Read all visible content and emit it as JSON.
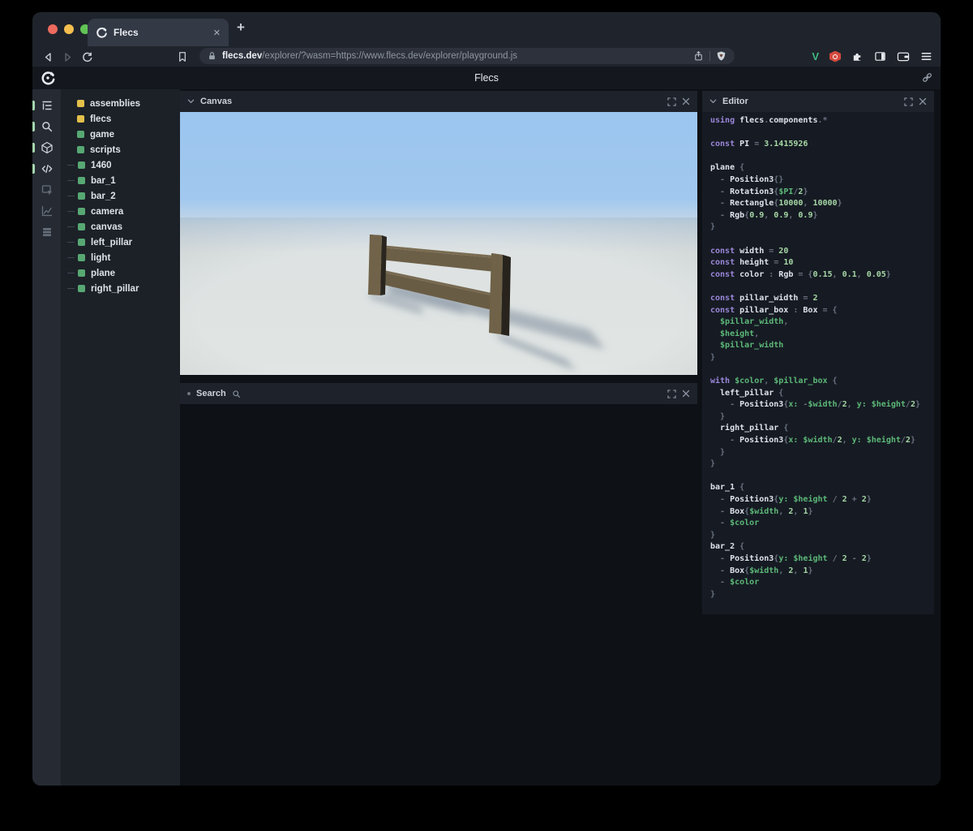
{
  "colors": {
    "traffic_red": "#ed6a5e",
    "traffic_yellow": "#f5bf4f",
    "traffic_green": "#61c454",
    "module_yellow": "#e3c04b",
    "entity_green": "#57a873",
    "rail_marker": "#a5d6ae",
    "syn_kw": "#9b86d9",
    "syn_id": "#dde3ea",
    "syn_pn": "#68707f",
    "syn_var": "#5cb878",
    "syn_num": "#a6d7a6",
    "ext_v_green": "#42b883",
    "ext_hex_red": "#d4493f",
    "sky_top": "#9bc5ef",
    "ground": "#e0e4e3",
    "fence_front": "#6e6148",
    "fence_side": "#2a261f",
    "fence_top": "#7a6c51",
    "shadow": "#5d7085"
  },
  "browser": {
    "tab_title": "Flecs",
    "close_glyph": "✕",
    "new_tab_glyph": "+",
    "url_domain": "flecs.dev",
    "url_path": "/explorer/?wasm=https://www.flecs.dev/explorer/playground.js",
    "ext_v_label": "V"
  },
  "page": {
    "title": "Flecs"
  },
  "icon_rail": {
    "items": [
      {
        "name": "tree",
        "active": true
      },
      {
        "name": "search",
        "active": true
      },
      {
        "name": "cube",
        "active": true
      },
      {
        "name": "code",
        "active": true
      },
      {
        "name": "inspector",
        "active": false
      },
      {
        "name": "chart",
        "active": false
      },
      {
        "name": "rows",
        "active": false
      }
    ]
  },
  "tree": {
    "items": [
      {
        "label": "assemblies",
        "type": "module",
        "expandable": true
      },
      {
        "label": "flecs",
        "type": "module",
        "expandable": true
      },
      {
        "label": "game",
        "type": "entity",
        "expandable": true
      },
      {
        "label": "scripts",
        "type": "entity",
        "expandable": true
      },
      {
        "label": "1460",
        "type": "entity",
        "expandable": false
      },
      {
        "label": "bar_1",
        "type": "entity",
        "expandable": false
      },
      {
        "label": "bar_2",
        "type": "entity",
        "expandable": false
      },
      {
        "label": "camera",
        "type": "entity",
        "expandable": false
      },
      {
        "label": "canvas",
        "type": "entity",
        "expandable": false
      },
      {
        "label": "left_pillar",
        "type": "entity",
        "expandable": false
      },
      {
        "label": "light",
        "type": "entity",
        "expandable": false
      },
      {
        "label": "plane",
        "type": "entity",
        "expandable": false
      },
      {
        "label": "right_pillar",
        "type": "entity",
        "expandable": false
      }
    ]
  },
  "panels": {
    "canvas_title": "Canvas",
    "search_title": "Search",
    "editor_title": "Editor"
  },
  "editor": {
    "code_lines": [
      [
        [
          "k",
          "using "
        ],
        [
          "i",
          "flecs"
        ],
        [
          "p",
          "."
        ],
        [
          "i",
          "components"
        ],
        [
          "p",
          ".*"
        ]
      ],
      [],
      [
        [
          "k",
          "const "
        ],
        [
          "i",
          "PI"
        ],
        [
          "p",
          " = "
        ],
        [
          "n",
          "3.1415926"
        ]
      ],
      [],
      [
        [
          "i",
          "plane "
        ],
        [
          "p",
          "{"
        ]
      ],
      [
        [
          "p",
          "  - "
        ],
        [
          "i",
          "Position3"
        ],
        [
          "p",
          "{}"
        ]
      ],
      [
        [
          "p",
          "  - "
        ],
        [
          "i",
          "Rotation3"
        ],
        [
          "p",
          "{"
        ],
        [
          "v",
          "$PI"
        ],
        [
          "p",
          "/"
        ],
        [
          "n",
          "2"
        ],
        [
          "p",
          "}"
        ]
      ],
      [
        [
          "p",
          "  - "
        ],
        [
          "i",
          "Rectangle"
        ],
        [
          "p",
          "{"
        ],
        [
          "n",
          "10000"
        ],
        [
          "p",
          ", "
        ],
        [
          "n",
          "10000"
        ],
        [
          "p",
          "}"
        ]
      ],
      [
        [
          "p",
          "  - "
        ],
        [
          "i",
          "Rgb"
        ],
        [
          "p",
          "{"
        ],
        [
          "n",
          "0.9"
        ],
        [
          "p",
          ", "
        ],
        [
          "n",
          "0.9"
        ],
        [
          "p",
          ", "
        ],
        [
          "n",
          "0.9"
        ],
        [
          "p",
          "}"
        ]
      ],
      [
        [
          "p",
          "}"
        ]
      ],
      [],
      [
        [
          "k",
          "const "
        ],
        [
          "i",
          "width"
        ],
        [
          "p",
          " = "
        ],
        [
          "n",
          "20"
        ]
      ],
      [
        [
          "k",
          "const "
        ],
        [
          "i",
          "height"
        ],
        [
          "p",
          " = "
        ],
        [
          "n",
          "10"
        ]
      ],
      [
        [
          "k",
          "const "
        ],
        [
          "i",
          "color"
        ],
        [
          "p",
          " : "
        ],
        [
          "i",
          "Rgb"
        ],
        [
          "p",
          " = {"
        ],
        [
          "n",
          "0.15"
        ],
        [
          "p",
          ", "
        ],
        [
          "n",
          "0.1"
        ],
        [
          "p",
          ", "
        ],
        [
          "n",
          "0.05"
        ],
        [
          "p",
          "}"
        ]
      ],
      [],
      [
        [
          "k",
          "const "
        ],
        [
          "i",
          "pillar_width"
        ],
        [
          "p",
          " = "
        ],
        [
          "n",
          "2"
        ]
      ],
      [
        [
          "k",
          "const "
        ],
        [
          "i",
          "pillar_box"
        ],
        [
          "p",
          " : "
        ],
        [
          "i",
          "Box"
        ],
        [
          "p",
          " = {"
        ]
      ],
      [
        [
          "v",
          "  $pillar_width"
        ],
        [
          "p",
          ","
        ]
      ],
      [
        [
          "v",
          "  $height"
        ],
        [
          "p",
          ","
        ]
      ],
      [
        [
          "v",
          "  $pillar_width"
        ]
      ],
      [
        [
          "p",
          "}"
        ]
      ],
      [],
      [
        [
          "k",
          "with "
        ],
        [
          "v",
          "$color"
        ],
        [
          "p",
          ", "
        ],
        [
          "v",
          "$pillar_box"
        ],
        [
          "p",
          " {"
        ]
      ],
      [
        [
          "i",
          "  left_pillar "
        ],
        [
          "p",
          "{"
        ]
      ],
      [
        [
          "p",
          "    - "
        ],
        [
          "i",
          "Position3"
        ],
        [
          "p",
          "{"
        ],
        [
          "v",
          "x:"
        ],
        [
          "p",
          " -"
        ],
        [
          "v",
          "$width"
        ],
        [
          "p",
          "/"
        ],
        [
          "n",
          "2"
        ],
        [
          "p",
          ", "
        ],
        [
          "v",
          "y:"
        ],
        [
          "p",
          " "
        ],
        [
          "v",
          "$height"
        ],
        [
          "p",
          "/"
        ],
        [
          "n",
          "2"
        ],
        [
          "p",
          "}"
        ]
      ],
      [
        [
          "p",
          "  }"
        ]
      ],
      [
        [
          "i",
          "  right_pillar "
        ],
        [
          "p",
          "{"
        ]
      ],
      [
        [
          "p",
          "    - "
        ],
        [
          "i",
          "Position3"
        ],
        [
          "p",
          "{"
        ],
        [
          "v",
          "x:"
        ],
        [
          "p",
          " "
        ],
        [
          "v",
          "$width"
        ],
        [
          "p",
          "/"
        ],
        [
          "n",
          "2"
        ],
        [
          "p",
          ", "
        ],
        [
          "v",
          "y:"
        ],
        [
          "p",
          " "
        ],
        [
          "v",
          "$height"
        ],
        [
          "p",
          "/"
        ],
        [
          "n",
          "2"
        ],
        [
          "p",
          "}"
        ]
      ],
      [
        [
          "p",
          "  }"
        ]
      ],
      [
        [
          "p",
          "}"
        ]
      ],
      [],
      [
        [
          "i",
          "bar_1 "
        ],
        [
          "p",
          "{"
        ]
      ],
      [
        [
          "p",
          "  - "
        ],
        [
          "i",
          "Position3"
        ],
        [
          "p",
          "{"
        ],
        [
          "v",
          "y:"
        ],
        [
          "p",
          " "
        ],
        [
          "v",
          "$height"
        ],
        [
          "p",
          " / "
        ],
        [
          "n",
          "2"
        ],
        [
          "p",
          " + "
        ],
        [
          "n",
          "2"
        ],
        [
          "p",
          "}"
        ]
      ],
      [
        [
          "p",
          "  - "
        ],
        [
          "i",
          "Box"
        ],
        [
          "p",
          "{"
        ],
        [
          "v",
          "$width"
        ],
        [
          "p",
          ", "
        ],
        [
          "n",
          "2"
        ],
        [
          "p",
          ", "
        ],
        [
          "n",
          "1"
        ],
        [
          "p",
          "}"
        ]
      ],
      [
        [
          "p",
          "  - "
        ],
        [
          "v",
          "$color"
        ]
      ],
      [
        [
          "p",
          "}"
        ]
      ],
      [
        [
          "i",
          "bar_2 "
        ],
        [
          "p",
          "{"
        ]
      ],
      [
        [
          "p",
          "  - "
        ],
        [
          "i",
          "Position3"
        ],
        [
          "p",
          "{"
        ],
        [
          "v",
          "y:"
        ],
        [
          "p",
          " "
        ],
        [
          "v",
          "$height"
        ],
        [
          "p",
          " / "
        ],
        [
          "n",
          "2"
        ],
        [
          "p",
          " - "
        ],
        [
          "n",
          "2"
        ],
        [
          "p",
          "}"
        ]
      ],
      [
        [
          "p",
          "  - "
        ],
        [
          "i",
          "Box"
        ],
        [
          "p",
          "{"
        ],
        [
          "v",
          "$width"
        ],
        [
          "p",
          ", "
        ],
        [
          "n",
          "2"
        ],
        [
          "p",
          ", "
        ],
        [
          "n",
          "1"
        ],
        [
          "p",
          "}"
        ]
      ],
      [
        [
          "p",
          "  - "
        ],
        [
          "v",
          "$color"
        ]
      ],
      [
        [
          "p",
          "}"
        ]
      ]
    ]
  }
}
